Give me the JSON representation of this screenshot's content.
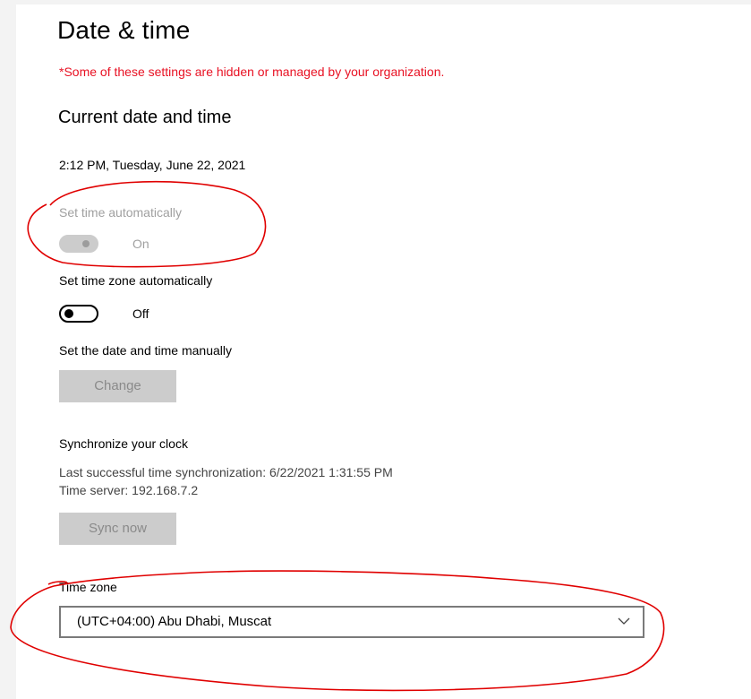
{
  "header": {
    "title": "Date & time",
    "managed_notice": "*Some of these settings are hidden or managed by your organization."
  },
  "current": {
    "section_title": "Current date and time",
    "datetime": "2:12 PM, Tuesday, June 22, 2021"
  },
  "set_time_auto": {
    "label": "Set time automatically",
    "state": "On"
  },
  "set_timezone_auto": {
    "label": "Set time zone automatically",
    "state": "Off"
  },
  "manual": {
    "label": "Set the date and time manually",
    "button": "Change"
  },
  "sync": {
    "title": "Synchronize your clock",
    "last_sync": "Last successful time synchronization: 6/22/2021 1:31:55 PM",
    "server": "Time server: 192.168.7.2",
    "button": "Sync now"
  },
  "timezone": {
    "label": "Time zone",
    "value": "(UTC+04:00) Abu Dhabi, Muscat"
  },
  "colors": {
    "notice": "#e81123",
    "annotation": "#e00000",
    "disabled": "#cccccc"
  }
}
